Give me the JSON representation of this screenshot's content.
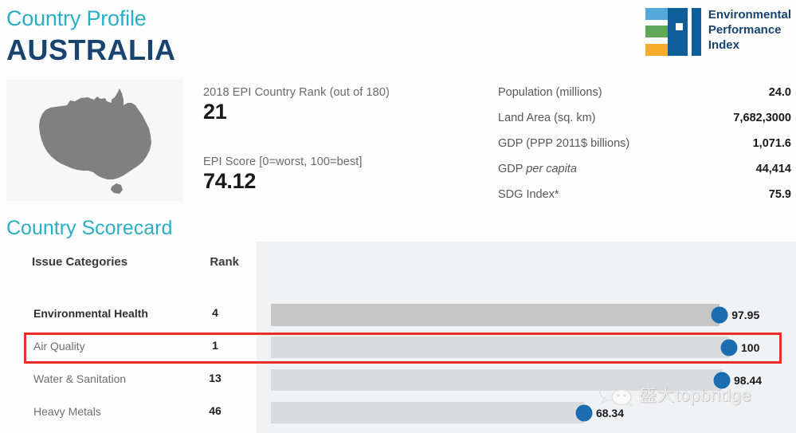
{
  "header": {
    "eyebrow": "Country Profile",
    "country": "AUSTRALIA",
    "logo": {
      "line1": "Environmental",
      "line2": "Performance",
      "line3": "Index",
      "mark_icon": "epi-logo-icon",
      "colors": {
        "bar_blue": "#55a9d9",
        "bar_green": "#5fa85a",
        "bar_orange": "#f6ad29",
        "letters": "#0f5d99"
      }
    }
  },
  "map": {
    "icon": "australia-map-icon",
    "fill": "#808080",
    "background": "#f7f7f7"
  },
  "epi_summary": {
    "rank_label": "2018 EPI Country Rank (out of 180)",
    "rank_value": "21",
    "score_label": "EPI Score [0=worst, 100=best]",
    "score_value": "74.12"
  },
  "country_stats": [
    {
      "label": "Population (millions)",
      "value": "24.0",
      "italic": ""
    },
    {
      "label": "Land Area (sq. km)",
      "value": "7,682,3000",
      "italic": ""
    },
    {
      "label": "GDP (PPP 2011$ billions)",
      "value": "1,071.6",
      "italic": ""
    },
    {
      "label": "GDP ",
      "italic": "per capita",
      "value": "44,414"
    },
    {
      "label": "SDG Index*",
      "value": "75.9",
      "italic": ""
    }
  ],
  "scorecard": {
    "title": "Country Scorecard",
    "columns": {
      "category": "Issue Categories",
      "rank": "Rank"
    },
    "highlighted_row": "Air Quality",
    "highlight_color": "#ee2d24"
  },
  "chart_data": {
    "type": "bar",
    "title": "Country Scorecard",
    "xlabel": "",
    "ylabel": "",
    "xlim": [
      0,
      100
    ],
    "grid": false,
    "legend": "none",
    "orientation": "horizontal",
    "categories": [
      "Environmental Health",
      "Air Quality",
      "Water & Sanitation",
      "Heavy Metals"
    ],
    "values": [
      97.95,
      100,
      98.44,
      68.34
    ],
    "ranks": [
      4,
      1,
      13,
      46
    ],
    "levels": [
      "parent",
      "child",
      "child",
      "child"
    ],
    "value_labels": [
      "97.95",
      "100",
      "98.44",
      "68.34"
    ],
    "rank_labels": [
      "4",
      "1",
      "13",
      "46"
    ],
    "marker_color": "#1b6cb0",
    "bar_color_parent": "#c6c6c6",
    "bar_color_child": "#d9dbdd",
    "panel_background": "#f1f2f4"
  },
  "watermark": {
    "icon": "wechat-icon",
    "text": "盛大topbridge"
  },
  "theme": {
    "teal": "#2bafc4",
    "navy": "#18446f",
    "accent_red": "#ee2d24"
  }
}
